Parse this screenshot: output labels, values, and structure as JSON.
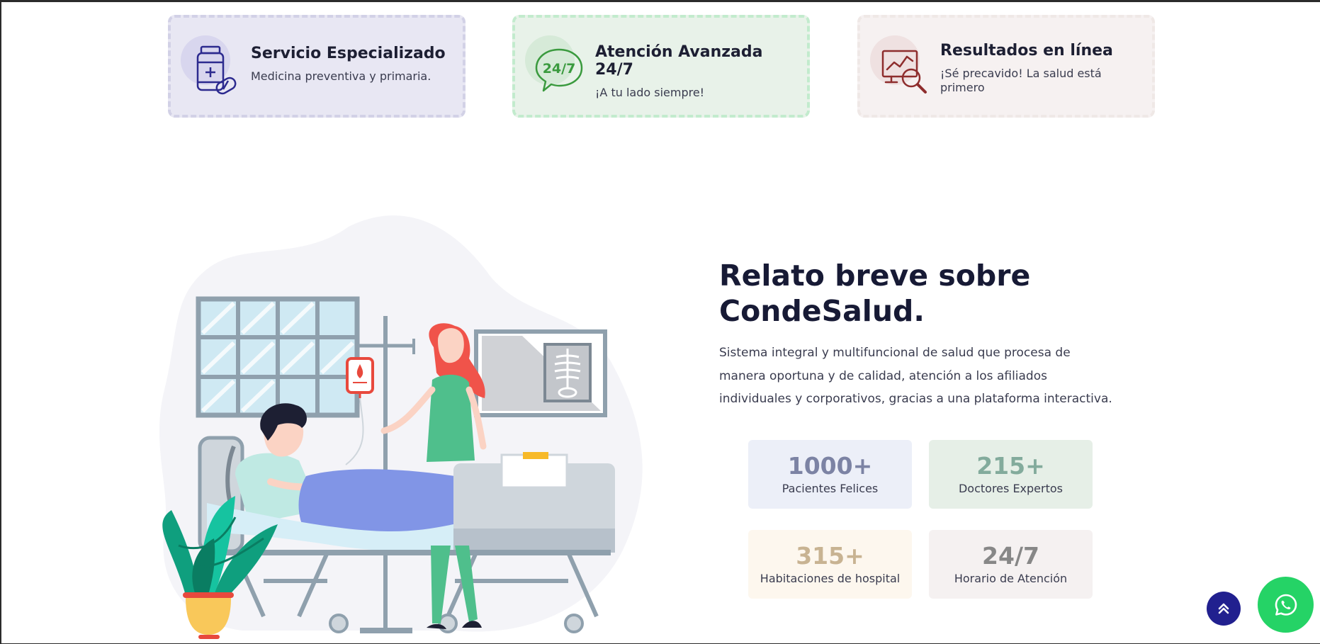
{
  "features": [
    {
      "title": "Servicio Especializado",
      "subtitle": "Medicina preventiva y primaria.",
      "icon": "medicine-bottle-icon",
      "accent": "#2c2a8f"
    },
    {
      "title": "Atención Avanzada 24/7",
      "subtitle": "¡A tu lado siempre!",
      "icon": "24-7-chat-icon",
      "accent": "#3a9a3e"
    },
    {
      "title": "Resultados en línea",
      "subtitle": "¡Sé precavido! La salud está primero",
      "icon": "results-search-icon",
      "accent": "#8e2d2d"
    }
  ],
  "about": {
    "title": "Relato breve sobre CondeSalud.",
    "description": "Sistema integral y multifuncional de salud que procesa de manera oportuna y de calidad, atención a los afiliados individuales y corporativos, gracias a una plataforma interactiva."
  },
  "stats": [
    {
      "value": "1000+",
      "label": "Pacientes Felices"
    },
    {
      "value": "215+",
      "label": "Doctores Expertos"
    },
    {
      "value": "315+",
      "label": "Habitaciones de hospital"
    },
    {
      "value": "24/7",
      "label": "Horario de Atención"
    }
  ],
  "floating": {
    "scroll_top_icon": "double-chevron-up-icon",
    "whatsapp_icon": "whatsapp-icon",
    "whatsapp_color": "#25d366",
    "scroll_top_color": "#21208f"
  }
}
